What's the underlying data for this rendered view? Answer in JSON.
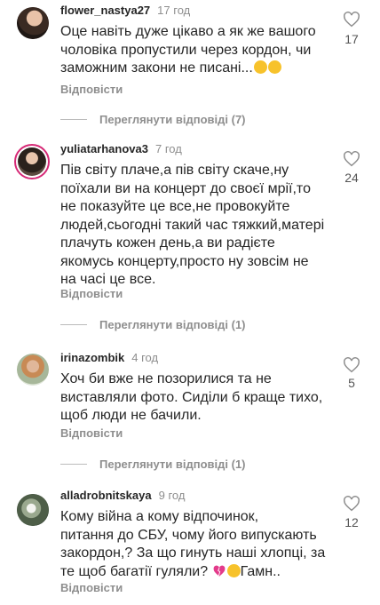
{
  "comments": [
    {
      "username": "flower_nastya27",
      "time": "17 год",
      "lines": [
        "Оце навіть дуже цікаво а як же вашого",
        "чоловіка пропустили через кордон, чи",
        "заможним закони не писані..."
      ],
      "likes": "17",
      "reply": "Відповісти",
      "view_replies": "Переглянути відповіді (7)"
    },
    {
      "username": "yuliatarhanova3",
      "time": "7 год",
      "lines": [
        "Пів світу плаче,а пів світу скаче,ну",
        "поїхали ви на концерт до своєї мрії,то",
        "не показуйте це все,не провокуйте",
        "людей,сьогодні такий час тяжкий,матері",
        "плачуть кожен день,а ви радієте",
        "якомусь концерту,просто ну зовсім не",
        "на часі це все."
      ],
      "likes": "24",
      "reply": "Відповісти",
      "view_replies": "Переглянути відповіді (1)"
    },
    {
      "username": "irinazombik",
      "time": "4 год",
      "lines": [
        "Хоч би вже не позорилися та не",
        "виставляли фото. Сиділи б краще тихо,",
        "щоб люди не бачили."
      ],
      "likes": "5",
      "reply": "Відповісти",
      "view_replies": "Переглянути відповіді (1)"
    },
    {
      "username": "alladrobnitskaya",
      "time": "9 год",
      "lines": [
        "Кому війна а кому відпочинок,",
        "питання до СБУ, чому його випускають",
        "закордон,? За що гинуть наші хлопці, за",
        "те щоб багатії гуляли?",
        " ",
        "Гамн.."
      ],
      "likes": "12",
      "reply": "Відповісти"
    }
  ],
  "colors": {
    "text": "#262626",
    "muted": "#8e8e8e",
    "story_ring": "#d62976"
  },
  "icons": {
    "like": "heart-outline-icon",
    "emoji1": "shushing-face-emoji",
    "emoji2": "broken-heart-emoji",
    "emoji3": "pensive-face-emoji"
  }
}
